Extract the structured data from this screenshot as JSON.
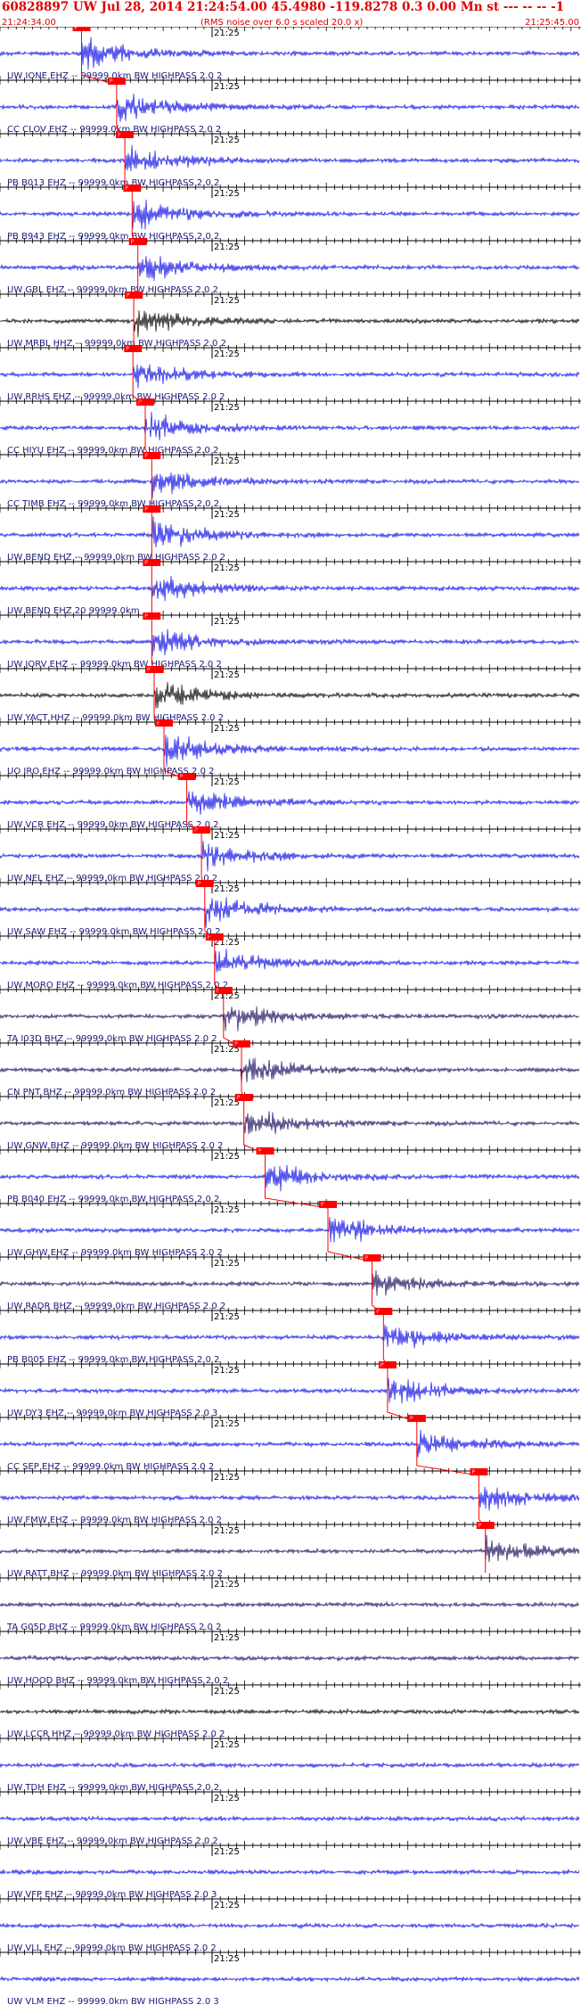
{
  "header": {
    "title": "60828897 UW Jul 28, 2014 21:24:54.00   45.4980 -119.8278  0.3 0.00 Mn st --- -- --  -1",
    "start_time": "21:24:34.00",
    "noise_note": "(RMS noise over 6.0 s scaled 20.0 x)",
    "end_time": "21:25:45.00",
    "color": "#dd0000"
  },
  "colors": {
    "trace_blue": "#1010e8",
    "trace_navy": "#1a1060",
    "trace_black": "#000000",
    "pick_red": "#ff0000",
    "label_navy": "#1a1a7a"
  },
  "chart_data": {
    "type": "line",
    "title": "",
    "xlabel": "",
    "ylabel": "",
    "x_unit": "seconds after 21:24:34.00",
    "xlim": [
      0,
      71
    ],
    "x_tick_label": "21:25",
    "x_tick_value": 26,
    "traces": [
      {
        "label": "UW IONE EHZ -- 99999.0km BW  HIGHPASS  2.0  2",
        "pick": 10.0,
        "color": "blue"
      },
      {
        "label": "CC CLOV EHZ -- 99999.0km BW  HIGHPASS  2.0  2",
        "pick": 14.3,
        "color": "blue"
      },
      {
        "label": "PB B013 EHZ -- 99999.0km BW  HIGHPASS  2.0  2",
        "pick": 15.3,
        "color": "blue"
      },
      {
        "label": "PB B943 EHZ -- 99999.0km BW  HIGHPASS  2.0  2",
        "pick": 16.2,
        "color": "blue"
      },
      {
        "label": "UW GBL EHZ -- 99999.0km BW  HIGHPASS  2.0  2",
        "pick": 16.9,
        "color": "blue"
      },
      {
        "label": "UW MRBL HHZ -- 99999.0km BW  HIGHPASS  2.0  2",
        "pick": 16.4,
        "color": "black"
      },
      {
        "label": "UW RRHS EHZ -- 99999.0km BW  HIGHPASS  2.0  2",
        "pick": 16.3,
        "color": "blue"
      },
      {
        "label": "CC HIYU EHZ -- 99999.0km BW  HIGHPASS  2.0  2",
        "pick": 17.8,
        "color": "blue"
      },
      {
        "label": "CC TIMB EHZ -- 99999.0km BW  HIGHPASS  2.0  2",
        "pick": 18.6,
        "color": "blue"
      },
      {
        "label": "UW BEND EHZ -- 99999.0km BW  HIGHPASS  2.0  2",
        "pick": 18.6,
        "color": "blue"
      },
      {
        "label": "UW BEND EHZ 20 99999.0km",
        "pick": 18.6,
        "color": "blue"
      },
      {
        "label": "UW JORV EHZ -- 99999.0km BW  HIGHPASS  2.0  2",
        "pick": 18.6,
        "color": "blue"
      },
      {
        "label": "UW YACT HHZ -- 99999.0km BW  HIGHPASS  2.0  2",
        "pick": 18.9,
        "color": "black"
      },
      {
        "label": "UO IRO EHZ -- 99999.0km BW  HIGHPASS  2.0  2",
        "pick": 20.1,
        "color": "blue"
      },
      {
        "label": "UW VCR EHZ -- 99999.0km BW  HIGHPASS  2.0  2",
        "pick": 22.9,
        "color": "blue"
      },
      {
        "label": "UW NEL EHZ -- 99999.0km BW  HIGHPASS  2.0  2",
        "pick": 24.7,
        "color": "blue"
      },
      {
        "label": "UW SAW EHZ -- 99999.0km BW  HIGHPASS  2.0  2",
        "pick": 25.1,
        "color": "blue"
      },
      {
        "label": "UW MORO EHZ -- 99999.0km BW  HIGHPASS  2.0  2",
        "pick": 26.3,
        "color": "blue"
      },
      {
        "label": "TA I03D BHZ -- 99999.0km BW  HIGHPASS  2.0  2",
        "pick": 27.4,
        "color": "navy"
      },
      {
        "label": "CN PNT BHZ -- 99999.0km BW  HIGHPASS  2.0  2",
        "pick": 29.6,
        "color": "navy"
      },
      {
        "label": "UW GNW BHZ -- 99999.0km BW  HIGHPASS  2.0  2",
        "pick": 29.9,
        "color": "navy"
      },
      {
        "label": "PB B040 EHZ -- 99999.0km BW  HIGHPASS  2.0  2",
        "pick": 32.5,
        "color": "blue"
      },
      {
        "label": "UW GHW EHZ -- 99999.0km BW  HIGHPASS  2.0  2",
        "pick": 40.2,
        "color": "blue"
      },
      {
        "label": "UW RADR BHZ -- 99999.0km BW  HIGHPASS  2.0  2",
        "pick": 45.6,
        "color": "navy"
      },
      {
        "label": "PB B005 EHZ -- 99999.0km BW  HIGHPASS  2.0  2",
        "pick": 47.0,
        "color": "blue"
      },
      {
        "label": "UW DY3 EHZ -- 99999.0km BW  HIGHPASS  2.0  3",
        "pick": 47.5,
        "color": "blue"
      },
      {
        "label": "CC SEP EHZ -- 99999.0km BW  HIGHPASS  2.0  2",
        "pick": 51.1,
        "color": "blue"
      },
      {
        "label": "UW FMW EHZ -- 99999.0km BW  HIGHPASS  2.0  2",
        "pick": 58.7,
        "color": "blue"
      },
      {
        "label": "UW RATT BHZ -- 99999.0km BW  HIGHPASS  2.0  2",
        "pick": 59.5,
        "color": "navy"
      },
      {
        "label": "TA G05D BHZ -- 99999.0km BW  HIGHPASS  2.0  2",
        "pick": null,
        "color": "navy"
      },
      {
        "label": "UW HOOD BHZ -- 99999.0km BW  HIGHPASS  2.0  2",
        "pick": null,
        "color": "navy"
      },
      {
        "label": "UW LCCR HHZ -- 99999.0km BW  HIGHPASS  2.0  2",
        "pick": null,
        "color": "black"
      },
      {
        "label": "UW TDH EHZ -- 99999.0km BW  HIGHPASS  2.0  2",
        "pick": null,
        "color": "blue"
      },
      {
        "label": "UW VBE EHZ -- 99999.0km BW  HIGHPASS  2.0  2",
        "pick": null,
        "color": "blue"
      },
      {
        "label": "UW VFP EHZ -- 99999.0km BW  HIGHPASS  2.0  3",
        "pick": null,
        "color": "blue"
      },
      {
        "label": "UW VLL EHZ -- 99999.0km BW  HIGHPASS  2.0  2",
        "pick": null,
        "color": "blue"
      },
      {
        "label": "UW VLM EHZ -- 99999.0km BW  HIGHPASS  2.0  3",
        "pick": null,
        "color": "blue"
      }
    ]
  }
}
